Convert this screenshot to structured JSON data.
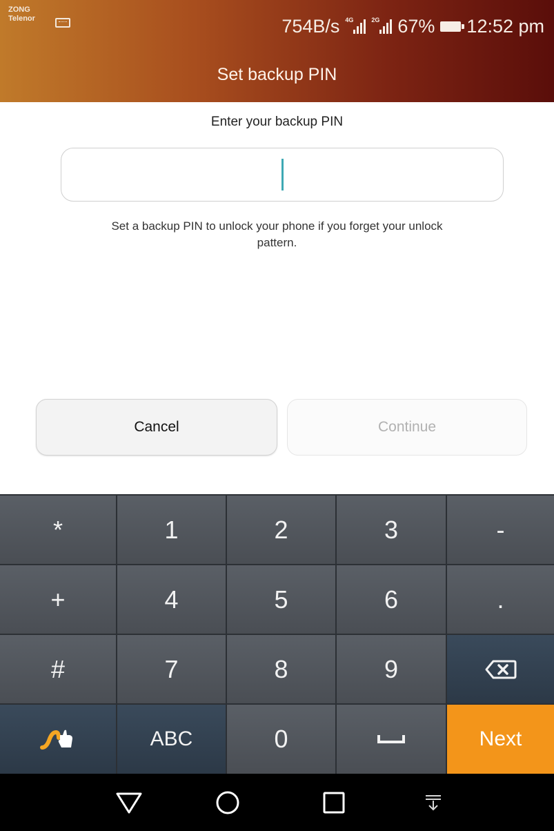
{
  "status_bar": {
    "carrier_1": "ZONG",
    "carrier_2": "Telenor",
    "speed": "754B/s",
    "sim1_type": "4G",
    "sim2_type": "2G",
    "battery": "67%",
    "time": "12:52 pm"
  },
  "header": {
    "title": "Set backup PIN"
  },
  "content": {
    "prompt": "Enter your backup PIN",
    "pin_value": "",
    "hint_line_1": "Set a backup PIN to unlock your phone if you forget your unlock",
    "hint_line_2": "pattern."
  },
  "buttons": {
    "cancel": "Cancel",
    "continue": "Continue"
  },
  "keypad": {
    "rows": [
      [
        "*",
        "1",
        "2",
        "3",
        "-"
      ],
      [
        "+",
        "4",
        "5",
        "6",
        "."
      ],
      [
        "#",
        "7",
        "8",
        "9",
        "backspace"
      ],
      [
        "swype",
        "ABC",
        "0",
        "space",
        "Next"
      ]
    ]
  },
  "icons": {
    "keyboard": "keyboard-icon",
    "battery": "battery-icon",
    "backspace": "backspace-icon",
    "swype": "swype-icon",
    "space": "space-icon",
    "nav_back": "back-icon",
    "nav_home": "home-icon",
    "nav_recent": "recent-apps-icon",
    "nav_notifications": "notifications-icon"
  },
  "colors": {
    "accent_caret": "#3ea9b4",
    "next_key": "#f3951a",
    "header_left": "#c07a2a",
    "header_right": "#5a0e0a"
  }
}
